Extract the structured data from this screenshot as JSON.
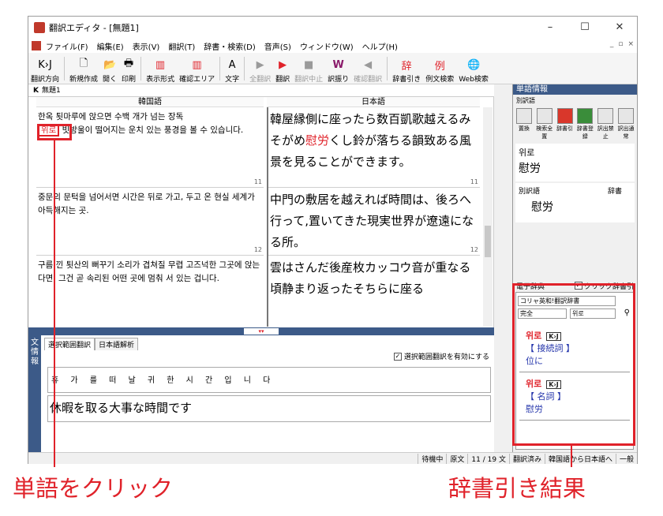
{
  "window": {
    "title": "翻訳エディタ - [無題1]",
    "controls": [
      "–",
      "☐",
      "✕"
    ]
  },
  "menu": [
    "ファイル(F)",
    "編集(E)",
    "表示(V)",
    "翻訳(T)",
    "辞書・検索(D)",
    "音声(S)",
    "ウィンドウ(W)",
    "ヘルプ(H)"
  ],
  "mdi_controls": [
    "_",
    "▫",
    "×"
  ],
  "toolbar": [
    {
      "label": "翻訳方向",
      "icon": "K›J",
      "disabled": false
    },
    {
      "label": "新規作成",
      "icon": "🗋",
      "disabled": false
    },
    {
      "label": "開く",
      "icon": "📂",
      "disabled": false
    },
    {
      "label": "印刷",
      "icon": "🖶",
      "disabled": false
    },
    {
      "label": "表示形式",
      "icon": "▥",
      "disabled": false
    },
    {
      "label": "確認エリア",
      "icon": "▥",
      "disabled": false
    },
    {
      "label": "文字",
      "icon": "A",
      "disabled": false
    },
    {
      "label": "全翻訳",
      "icon": "▶",
      "disabled": true
    },
    {
      "label": "翻訳",
      "icon": "▶",
      "disabled": false
    },
    {
      "label": "翻訳中止",
      "icon": "■",
      "disabled": true
    },
    {
      "label": "訳振り",
      "icon": "W",
      "disabled": false
    },
    {
      "label": "確認翻訳",
      "icon": "◀",
      "disabled": true
    },
    {
      "label": "辞書引き",
      "icon": "辞",
      "disabled": false
    },
    {
      "label": "例文検索",
      "icon": "例",
      "disabled": false
    },
    {
      "label": "Web検索",
      "icon": "🌐",
      "disabled": false
    }
  ],
  "doc_tab": {
    "prefix": "K",
    "name": "無題1"
  },
  "editor": {
    "korean_header": "韓国語",
    "japanese_header": "日本語",
    "segments": [
      {
        "ko_pre": "한옥 툇마루에 앉으면 수백 개가 넘는 장독",
        "ko_highlight": "위로",
        "ko_post": " 빗방울이 떨어지는 운치 있는 풍경을 볼 수 있습니다.",
        "ja_pre": "韓屋縁側に座ったら数百凱歌越えるみそがめ",
        "ja_highlight": "慰労",
        "ja_post": "くし鈴が落ちる韻致ある風景を見ることができます。",
        "num": "11"
      },
      {
        "ko": "중문의 문턱을 넘어서면 시간은 뒤로 가고, 두고 온 현실 세계가 아득해지는 곳.",
        "ja": "中門の敷居を越えれば時間は、後ろへ行って,置いてきた現実世界が遼遠になる所。",
        "num": "12"
      },
      {
        "ko": "구름 낀 툇산의 뻐꾸기 소리가 겹쳐질 무렵 고즈넉한 그곳에 앉는다면, 그건 곧 속리된 어떤 곳에 멈춰 서 있는 겁니다.",
        "ja": "雲はさんだ後産枚カッコウ音が重なる頃静まり返ったそちらに座る",
        "num": ""
      }
    ]
  },
  "bottom": {
    "side_label": "文情報",
    "tabs": [
      "選択範囲翻訳",
      "日本語解析"
    ],
    "checkbox_label": "選択範囲翻訳を有効にする",
    "source_text": "휴 가 를  떠 날  귀 한  시 간 입 니 다",
    "translation": "休暇を取る大事な時間です"
  },
  "word_info": {
    "title": "単語情報",
    "sub": "別訳語",
    "icons": [
      "置換",
      "検索全置",
      "辞書引",
      "辞書登録",
      "訳出禁止",
      "訳出通常"
    ],
    "word": "위로",
    "translation": "慰労",
    "alt_label": "別訳語",
    "dict_label": "辞書",
    "alt_word": "慰労"
  },
  "edict": {
    "title": "電子辞典",
    "click_label": "クリック辞書引",
    "dict_select": "コリャ英和!翻訳辞書",
    "match_select": "完全",
    "query": "위로",
    "entries": [
      {
        "word": "위로",
        "badge": "K›J",
        "pos": "【 接続詞 】",
        "trans": "位に"
      },
      {
        "word": "위로",
        "badge": "K›J",
        "pos": "【 名詞 】",
        "trans": "慰労"
      }
    ]
  },
  "status": [
    "待機中",
    "原文",
    "11 / 19 文",
    "翻訳済み",
    "韓国語から日本語へ",
    "一般"
  ],
  "annotations": {
    "left": "単語をクリック",
    "right": "辞書引き結果"
  }
}
